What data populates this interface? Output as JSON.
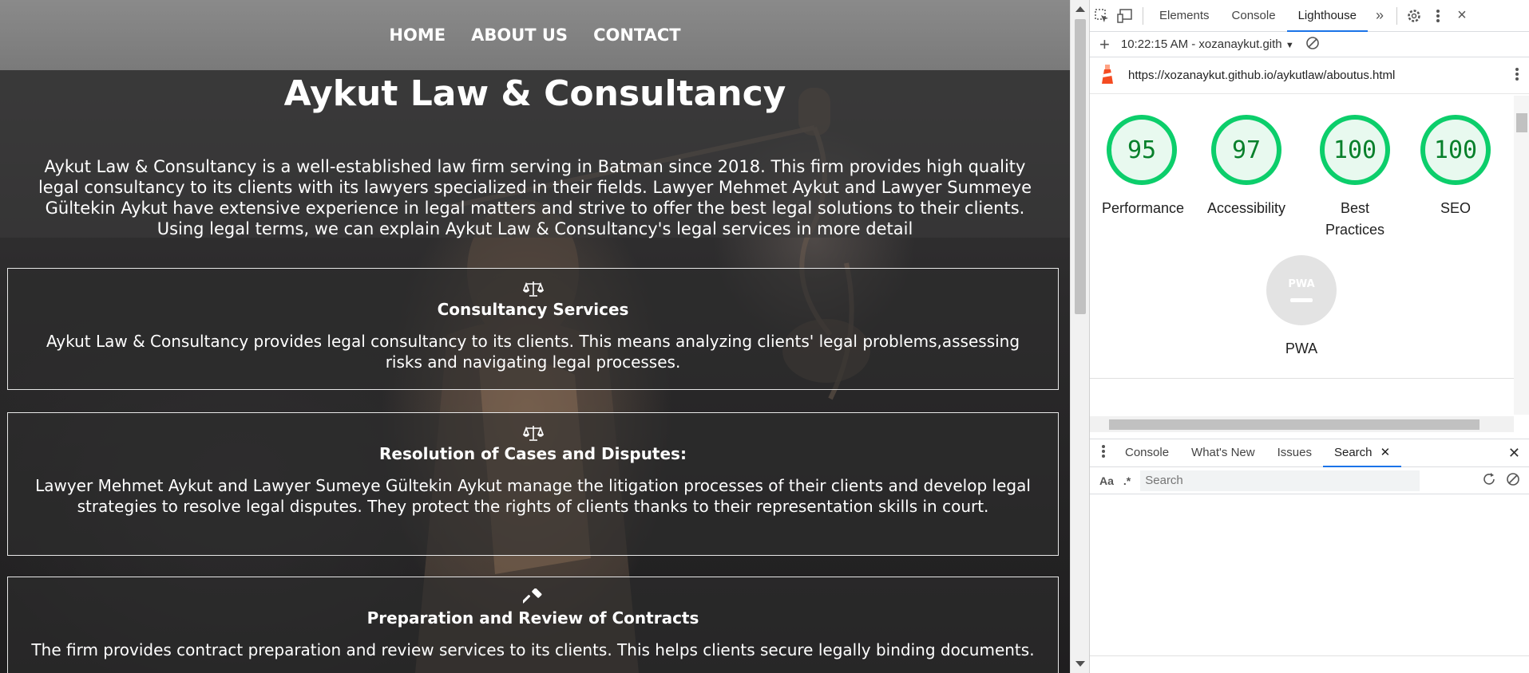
{
  "site": {
    "nav": [
      "HOME",
      "ABOUT US",
      "CONTACT"
    ],
    "title": "Aykut Law & Consultancy",
    "intro": "Aykut Law & Consultancy is a well-established law firm serving in Batman since 2018. This firm provides high quality legal consultancy to its clients with its lawyers specialized in their fields. Lawyer Mehmet Aykut and Lawyer Summeye Gültekin Aykut have extensive experience in legal matters and strive to offer the best legal solutions to their clients. Using legal terms, we can explain Aykut Law & Consultancy's legal services in more detail",
    "cards": [
      {
        "icon": "scale-icon",
        "title": "Consultancy Services",
        "text": "Aykut Law & Consultancy provides legal consultancy to its clients. This means analyzing clients' legal problems,assessing risks and navigating legal processes."
      },
      {
        "icon": "scale-icon",
        "title": "Resolution of Cases and Disputes:",
        "text": "Lawyer Mehmet Aykut and Lawyer Sumeye Gültekin Aykut manage the litigation processes of their clients and develop legal strategies to resolve legal disputes. They protect the rights of clients thanks to their representation skills in court."
      },
      {
        "icon": "gavel-icon",
        "title": "Preparation and Review of Contracts",
        "text": "The firm provides contract preparation and review services to its clients. This helps clients secure legally binding documents."
      }
    ]
  },
  "devtools": {
    "tabs": [
      "Elements",
      "Console",
      "Lighthouse"
    ],
    "active_tab": "Lighthouse",
    "report_selector": "10:22:15 AM - xozanaykut.gith",
    "url": "https://xozanaykut.github.io/aykutlaw/aboutus.html",
    "scores": [
      {
        "label": "Performance",
        "value": "95"
      },
      {
        "label": "Accessibility",
        "value": "97"
      },
      {
        "label": "Best Practices",
        "value": "100"
      },
      {
        "label": "SEO",
        "value": "100"
      }
    ],
    "pwa": {
      "label": "PWA",
      "badge": "PWA"
    },
    "drawer_tabs": [
      "Console",
      "What's New",
      "Issues",
      "Search"
    ],
    "drawer_active": "Search",
    "search": {
      "case_label": "Aa",
      "regex_label": ".*",
      "placeholder": "Search"
    },
    "colors": {
      "pass": "#0cce6b",
      "pass_text": "#08802b",
      "accent": "#1a73e8"
    }
  }
}
